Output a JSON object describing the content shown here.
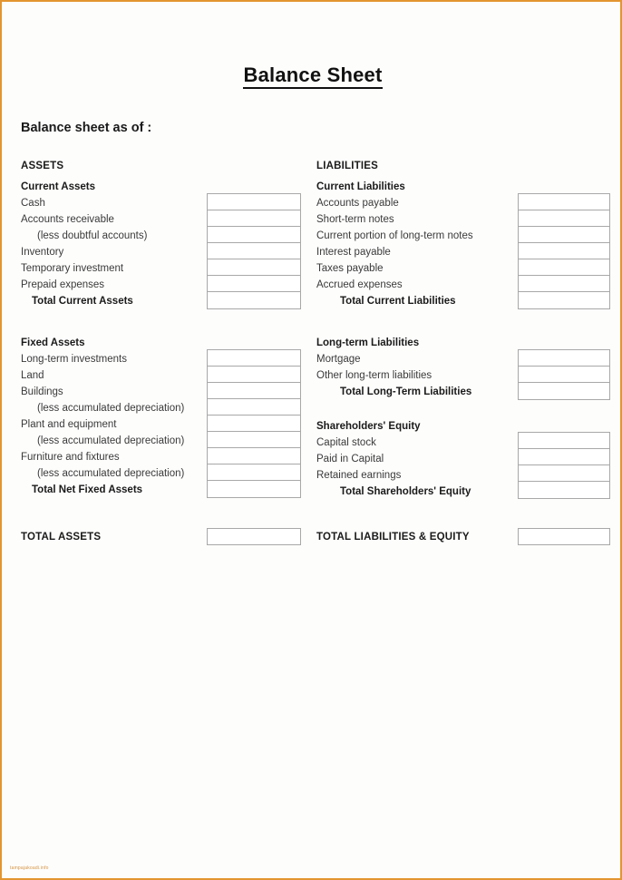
{
  "document": {
    "title": "Balance Sheet",
    "as_of_label": "Balance sheet as of :"
  },
  "columns": {
    "assets_header": "ASSETS",
    "liabilities_header": "LIABILITIES"
  },
  "assets": {
    "current": {
      "section_title": "Current Assets",
      "rows": [
        {
          "label": "Cash",
          "style": "plain",
          "value": ""
        },
        {
          "label": "Accounts receivable",
          "style": "plain",
          "value": ""
        },
        {
          "label": "(less doubtful accounts)",
          "style": "indent",
          "value": ""
        },
        {
          "label": "Inventory",
          "style": "plain",
          "value": ""
        },
        {
          "label": "Temporary investment",
          "style": "plain",
          "value": ""
        },
        {
          "label": "Prepaid expenses",
          "style": "plain",
          "value": ""
        },
        {
          "label": "Total Current Assets",
          "style": "total",
          "value": ""
        }
      ]
    },
    "fixed": {
      "section_title": "Fixed Assets",
      "rows": [
        {
          "label": "Long-term investments",
          "style": "plain",
          "value": ""
        },
        {
          "label": "Land",
          "style": "plain",
          "value": ""
        },
        {
          "label": "Buildings",
          "style": "plain",
          "value": ""
        },
        {
          "label": "(less accumulated depreciation)",
          "style": "indent",
          "value": ""
        },
        {
          "label": "Plant and equipment",
          "style": "plain",
          "value": ""
        },
        {
          "label": "(less accumulated depreciation)",
          "style": "indent",
          "value": ""
        },
        {
          "label": "Furniture and fixtures",
          "style": "plain",
          "value": ""
        },
        {
          "label": "(less accumulated depreciation)",
          "style": "indent",
          "value": ""
        },
        {
          "label": "Total Net Fixed Assets",
          "style": "total",
          "value": ""
        }
      ]
    },
    "grand_total_label": "TOTAL ASSETS",
    "grand_total_value": ""
  },
  "liabilities": {
    "current": {
      "section_title": "Current Liabilities",
      "rows": [
        {
          "label": "Accounts payable",
          "style": "plain",
          "value": ""
        },
        {
          "label": "Short-term notes",
          "style": "plain",
          "value": ""
        },
        {
          "label": "Current portion of long-term notes",
          "style": "plain",
          "value": ""
        },
        {
          "label": "Interest payable",
          "style": "plain",
          "value": ""
        },
        {
          "label": "Taxes payable",
          "style": "plain",
          "value": ""
        },
        {
          "label": "Accrued expenses",
          "style": "plain",
          "value": ""
        },
        {
          "label": "Total Current Liabilities",
          "style": "total-deep",
          "value": ""
        }
      ]
    },
    "long_term": {
      "section_title": "Long-term Liabilities",
      "rows": [
        {
          "label": "Mortgage",
          "style": "plain",
          "value": ""
        },
        {
          "label": "Other long-term liabilities",
          "style": "plain",
          "value": ""
        },
        {
          "label": "Total Long-Term Liabilities",
          "style": "total-deep",
          "value": ""
        }
      ]
    },
    "equity": {
      "section_title": "Shareholders' Equity",
      "rows": [
        {
          "label": "Capital stock",
          "style": "plain",
          "value": ""
        },
        {
          "label": "Paid in Capital",
          "style": "plain",
          "value": ""
        },
        {
          "label": "Retained earnings",
          "style": "plain",
          "value": ""
        },
        {
          "label": "Total Shareholders' Equity",
          "style": "total-deep",
          "value": ""
        }
      ]
    },
    "grand_total_label": "TOTAL LIABILITIES & EQUITY",
    "grand_total_value": ""
  },
  "footer": {
    "watermark": "tampajakoadi.info"
  },
  "colors": {
    "page_border": "#e3952f",
    "box_border": "#a8a8a8",
    "text": "#1a1a1a",
    "muted_text": "#3a3a3a",
    "watermark": "#d79440"
  }
}
